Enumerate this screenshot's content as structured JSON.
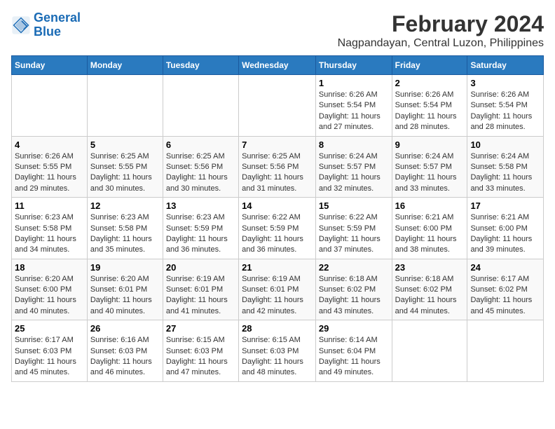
{
  "logo": {
    "line1": "General",
    "line2": "Blue"
  },
  "title": "February 2024",
  "subtitle": "Nagpandayan, Central Luzon, Philippines",
  "headers": [
    "Sunday",
    "Monday",
    "Tuesday",
    "Wednesday",
    "Thursday",
    "Friday",
    "Saturday"
  ],
  "weeks": [
    [
      {
        "day": "",
        "info": ""
      },
      {
        "day": "",
        "info": ""
      },
      {
        "day": "",
        "info": ""
      },
      {
        "day": "",
        "info": ""
      },
      {
        "day": "1",
        "sunrise": "6:26 AM",
        "sunset": "5:54 PM",
        "daylight": "11 hours and 27 minutes."
      },
      {
        "day": "2",
        "sunrise": "6:26 AM",
        "sunset": "5:54 PM",
        "daylight": "11 hours and 28 minutes."
      },
      {
        "day": "3",
        "sunrise": "6:26 AM",
        "sunset": "5:54 PM",
        "daylight": "11 hours and 28 minutes."
      }
    ],
    [
      {
        "day": "4",
        "sunrise": "6:26 AM",
        "sunset": "5:55 PM",
        "daylight": "11 hours and 29 minutes."
      },
      {
        "day": "5",
        "sunrise": "6:25 AM",
        "sunset": "5:55 PM",
        "daylight": "11 hours and 30 minutes."
      },
      {
        "day": "6",
        "sunrise": "6:25 AM",
        "sunset": "5:56 PM",
        "daylight": "11 hours and 30 minutes."
      },
      {
        "day": "7",
        "sunrise": "6:25 AM",
        "sunset": "5:56 PM",
        "daylight": "11 hours and 31 minutes."
      },
      {
        "day": "8",
        "sunrise": "6:24 AM",
        "sunset": "5:57 PM",
        "daylight": "11 hours and 32 minutes."
      },
      {
        "day": "9",
        "sunrise": "6:24 AM",
        "sunset": "5:57 PM",
        "daylight": "11 hours and 33 minutes."
      },
      {
        "day": "10",
        "sunrise": "6:24 AM",
        "sunset": "5:58 PM",
        "daylight": "11 hours and 33 minutes."
      }
    ],
    [
      {
        "day": "11",
        "sunrise": "6:23 AM",
        "sunset": "5:58 PM",
        "daylight": "11 hours and 34 minutes."
      },
      {
        "day": "12",
        "sunrise": "6:23 AM",
        "sunset": "5:58 PM",
        "daylight": "11 hours and 35 minutes."
      },
      {
        "day": "13",
        "sunrise": "6:23 AM",
        "sunset": "5:59 PM",
        "daylight": "11 hours and 36 minutes."
      },
      {
        "day": "14",
        "sunrise": "6:22 AM",
        "sunset": "5:59 PM",
        "daylight": "11 hours and 36 minutes."
      },
      {
        "day": "15",
        "sunrise": "6:22 AM",
        "sunset": "5:59 PM",
        "daylight": "11 hours and 37 minutes."
      },
      {
        "day": "16",
        "sunrise": "6:21 AM",
        "sunset": "6:00 PM",
        "daylight": "11 hours and 38 minutes."
      },
      {
        "day": "17",
        "sunrise": "6:21 AM",
        "sunset": "6:00 PM",
        "daylight": "11 hours and 39 minutes."
      }
    ],
    [
      {
        "day": "18",
        "sunrise": "6:20 AM",
        "sunset": "6:00 PM",
        "daylight": "11 hours and 40 minutes."
      },
      {
        "day": "19",
        "sunrise": "6:20 AM",
        "sunset": "6:01 PM",
        "daylight": "11 hours and 40 minutes."
      },
      {
        "day": "20",
        "sunrise": "6:19 AM",
        "sunset": "6:01 PM",
        "daylight": "11 hours and 41 minutes."
      },
      {
        "day": "21",
        "sunrise": "6:19 AM",
        "sunset": "6:01 PM",
        "daylight": "11 hours and 42 minutes."
      },
      {
        "day": "22",
        "sunrise": "6:18 AM",
        "sunset": "6:02 PM",
        "daylight": "11 hours and 43 minutes."
      },
      {
        "day": "23",
        "sunrise": "6:18 AM",
        "sunset": "6:02 PM",
        "daylight": "11 hours and 44 minutes."
      },
      {
        "day": "24",
        "sunrise": "6:17 AM",
        "sunset": "6:02 PM",
        "daylight": "11 hours and 45 minutes."
      }
    ],
    [
      {
        "day": "25",
        "sunrise": "6:17 AM",
        "sunset": "6:03 PM",
        "daylight": "11 hours and 45 minutes."
      },
      {
        "day": "26",
        "sunrise": "6:16 AM",
        "sunset": "6:03 PM",
        "daylight": "11 hours and 46 minutes."
      },
      {
        "day": "27",
        "sunrise": "6:15 AM",
        "sunset": "6:03 PM",
        "daylight": "11 hours and 47 minutes."
      },
      {
        "day": "28",
        "sunrise": "6:15 AM",
        "sunset": "6:03 PM",
        "daylight": "11 hours and 48 minutes."
      },
      {
        "day": "29",
        "sunrise": "6:14 AM",
        "sunset": "6:04 PM",
        "daylight": "11 hours and 49 minutes."
      },
      {
        "day": "",
        "info": ""
      },
      {
        "day": "",
        "info": ""
      }
    ]
  ]
}
